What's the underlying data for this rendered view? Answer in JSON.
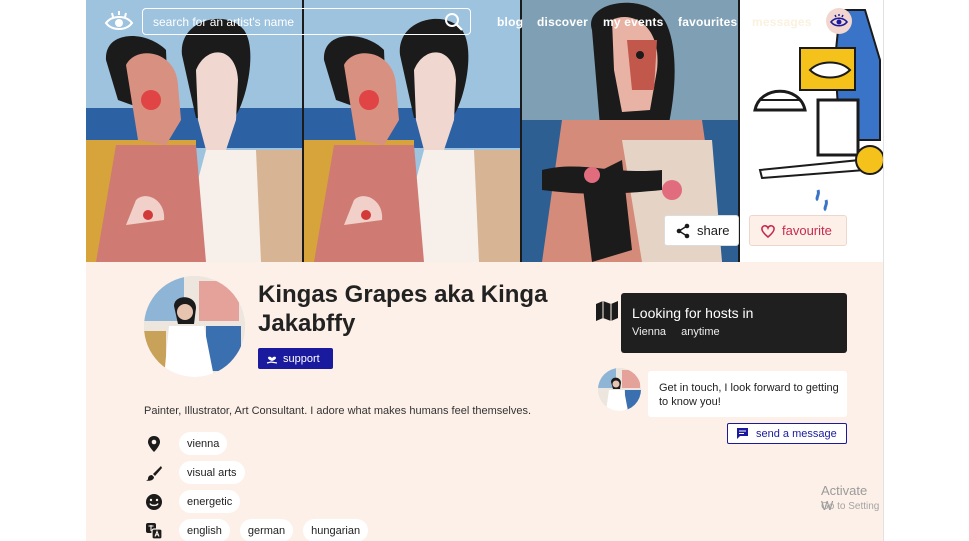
{
  "nav": {
    "search_placeholder": "search for an artist's name",
    "links": [
      "blog",
      "discover",
      "my events",
      "favourites",
      "messages"
    ]
  },
  "hero_actions": {
    "share_label": "share",
    "favourite_label": "favourite"
  },
  "profile": {
    "name": "Kingas Grapes aka Kinga Jakabffy",
    "support_label": "support",
    "bio": "Painter, Illustrator, Art Consultant. I adore what makes humans feel themselves.",
    "tags": {
      "location": [
        "vienna"
      ],
      "disciplines": [
        "visual arts"
      ],
      "mood": [
        "energetic"
      ],
      "languages": [
        "english",
        "german",
        "hungarian"
      ]
    }
  },
  "hosting": {
    "title": "Looking for hosts in",
    "city": "Vienna",
    "time": "anytime"
  },
  "contact": {
    "message": "Get in touch, I look forward to getting to know you!",
    "send_label": "send a message"
  },
  "system_watermark": {
    "line1": "Activate W",
    "line2": "Go to Setting"
  },
  "colors": {
    "accent_blue": "#1a1a9e",
    "favourite_red": "#c82a4d",
    "background_peach": "#fdf0e8",
    "dark_box": "#1f1f1f"
  }
}
